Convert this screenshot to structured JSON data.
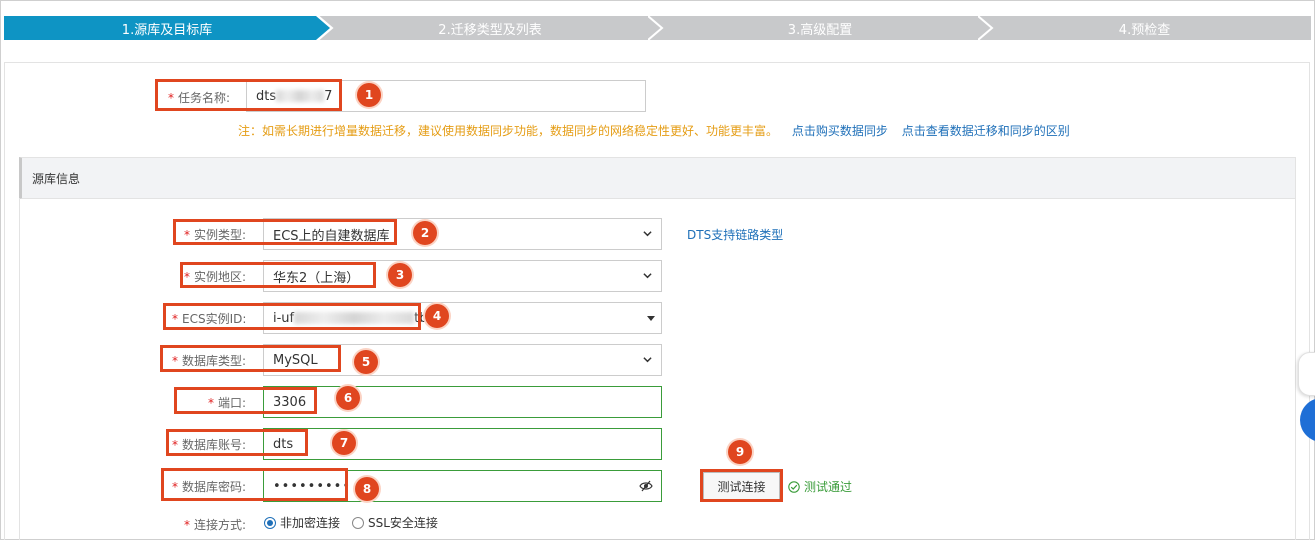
{
  "steps": [
    {
      "label": "1.源库及目标库",
      "active": true
    },
    {
      "label": "2.迁移类型及列表",
      "active": false
    },
    {
      "label": "3.高级配置",
      "active": false
    },
    {
      "label": "4.预检查",
      "active": false
    }
  ],
  "task": {
    "label": "任务名称:",
    "value_prefix": "dts",
    "value_suffix": "7"
  },
  "note": {
    "warning": "注：如需长期进行增量数据迁移，建议使用数据同步功能，数据同步的网络稳定性更好、功能更丰富。",
    "link_buy": "点击购买数据同步",
    "link_diff": "点击查看数据迁移和同步的区别"
  },
  "source": {
    "section_title": "源库信息",
    "instance_type": {
      "label": "实例类型:",
      "value": "ECS上的自建数据库"
    },
    "support_link": "DTS支持链路类型",
    "region": {
      "label": "实例地区:",
      "value": "华东2（上海）"
    },
    "ecs_id": {
      "label": "ECS实例ID:",
      "value_prefix": "i-uf",
      "value_suffix": "tb"
    },
    "db_type": {
      "label": "数据库类型:",
      "value": "MySQL"
    },
    "port": {
      "label": "端口:",
      "value": "3306"
    },
    "account": {
      "label": "数据库账号:",
      "value": "dts"
    },
    "password": {
      "label": "数据库密码:",
      "value": "•••••••••"
    },
    "test_button": "测试连接",
    "test_result": "测试通过",
    "connection": {
      "label": "连接方式:",
      "options": [
        "非加密连接",
        "SSL安全连接"
      ],
      "selected": "非加密连接"
    }
  },
  "badges": [
    "1",
    "2",
    "3",
    "4",
    "5",
    "6",
    "7",
    "8",
    "9"
  ],
  "colors": {
    "step_active": "#0e94c4",
    "step_inactive": "#c8c9cb",
    "highlight": "#e0461f",
    "valid": "#3a9c3a",
    "link": "#1e6fb8",
    "warning": "#e59d15"
  }
}
